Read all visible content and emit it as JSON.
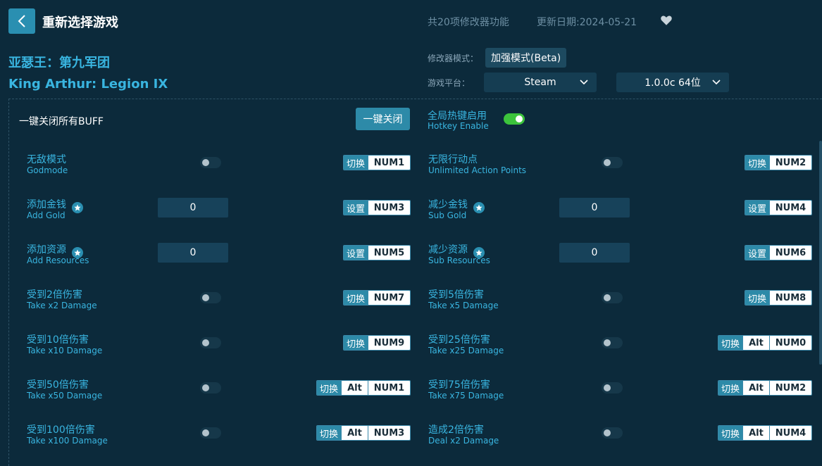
{
  "header": {
    "title": "重新选择游戏",
    "feature_count": "共20项修改器功能",
    "update_date": "更新日期:2024-05-21"
  },
  "game": {
    "name_cn": "亚瑟王：第九军团",
    "name_en": "King Arthur: Legion IX"
  },
  "settings": {
    "mode_label": "修改器模式：",
    "mode_value": "加强模式(Beta)",
    "platform_label": "游戏平台：",
    "platform_value": "Steam",
    "version_value": "1.0.0c 64位"
  },
  "controls": {
    "all_buff_label": "一键关闭所有BUFF",
    "close_all_button": "一键关闭",
    "hotkey_cn": "全局热键启用",
    "hotkey_en": "Hotkey Enable",
    "hotkey_enabled": true
  },
  "cheats": [
    {
      "cn": "无敌模式",
      "en": "Godmode",
      "type": "toggle",
      "action": "切换",
      "keys": [
        "NUM1"
      ]
    },
    {
      "cn": "无限行动点",
      "en": "Unlimited Action Points",
      "type": "toggle",
      "action": "切换",
      "keys": [
        "NUM2"
      ]
    },
    {
      "cn": "添加金钱",
      "en": "Add Gold",
      "type": "input",
      "value": "0",
      "starred": true,
      "action": "设置",
      "keys": [
        "NUM3"
      ]
    },
    {
      "cn": "减少金钱",
      "en": "Sub Gold",
      "type": "input",
      "value": "0",
      "starred": true,
      "action": "设置",
      "keys": [
        "NUM4"
      ]
    },
    {
      "cn": "添加资源",
      "en": "Add Resources",
      "type": "input",
      "value": "0",
      "starred": true,
      "action": "设置",
      "keys": [
        "NUM5"
      ]
    },
    {
      "cn": "减少资源",
      "en": "Sub Resources",
      "type": "input",
      "value": "0",
      "starred": true,
      "action": "设置",
      "keys": [
        "NUM6"
      ]
    },
    {
      "cn": "受到2倍伤害",
      "en": "Take x2 Damage",
      "type": "toggle",
      "action": "切换",
      "keys": [
        "NUM7"
      ]
    },
    {
      "cn": "受到5倍伤害",
      "en": "Take x5 Damage",
      "type": "toggle",
      "action": "切换",
      "keys": [
        "NUM8"
      ]
    },
    {
      "cn": "受到10倍伤害",
      "en": "Take x10 Damage",
      "type": "toggle",
      "action": "切换",
      "keys": [
        "NUM9"
      ]
    },
    {
      "cn": "受到25倍伤害",
      "en": "Take x25 Damage",
      "type": "toggle",
      "action": "切换",
      "keys": [
        "Alt",
        "NUM0"
      ]
    },
    {
      "cn": "受到50倍伤害",
      "en": "Take x50 Damage",
      "type": "toggle",
      "action": "切换",
      "keys": [
        "Alt",
        "NUM1"
      ]
    },
    {
      "cn": "受到75倍伤害",
      "en": "Take x75 Damage",
      "type": "toggle",
      "action": "切换",
      "keys": [
        "Alt",
        "NUM2"
      ]
    },
    {
      "cn": "受到100倍伤害",
      "en": "Take x100 Damage",
      "type": "toggle",
      "action": "切换",
      "keys": [
        "Alt",
        "NUM3"
      ]
    },
    {
      "cn": "造成2倍伤害",
      "en": "Deal x2 Damage",
      "type": "toggle",
      "action": "切换",
      "keys": [
        "Alt",
        "NUM4"
      ]
    }
  ]
}
